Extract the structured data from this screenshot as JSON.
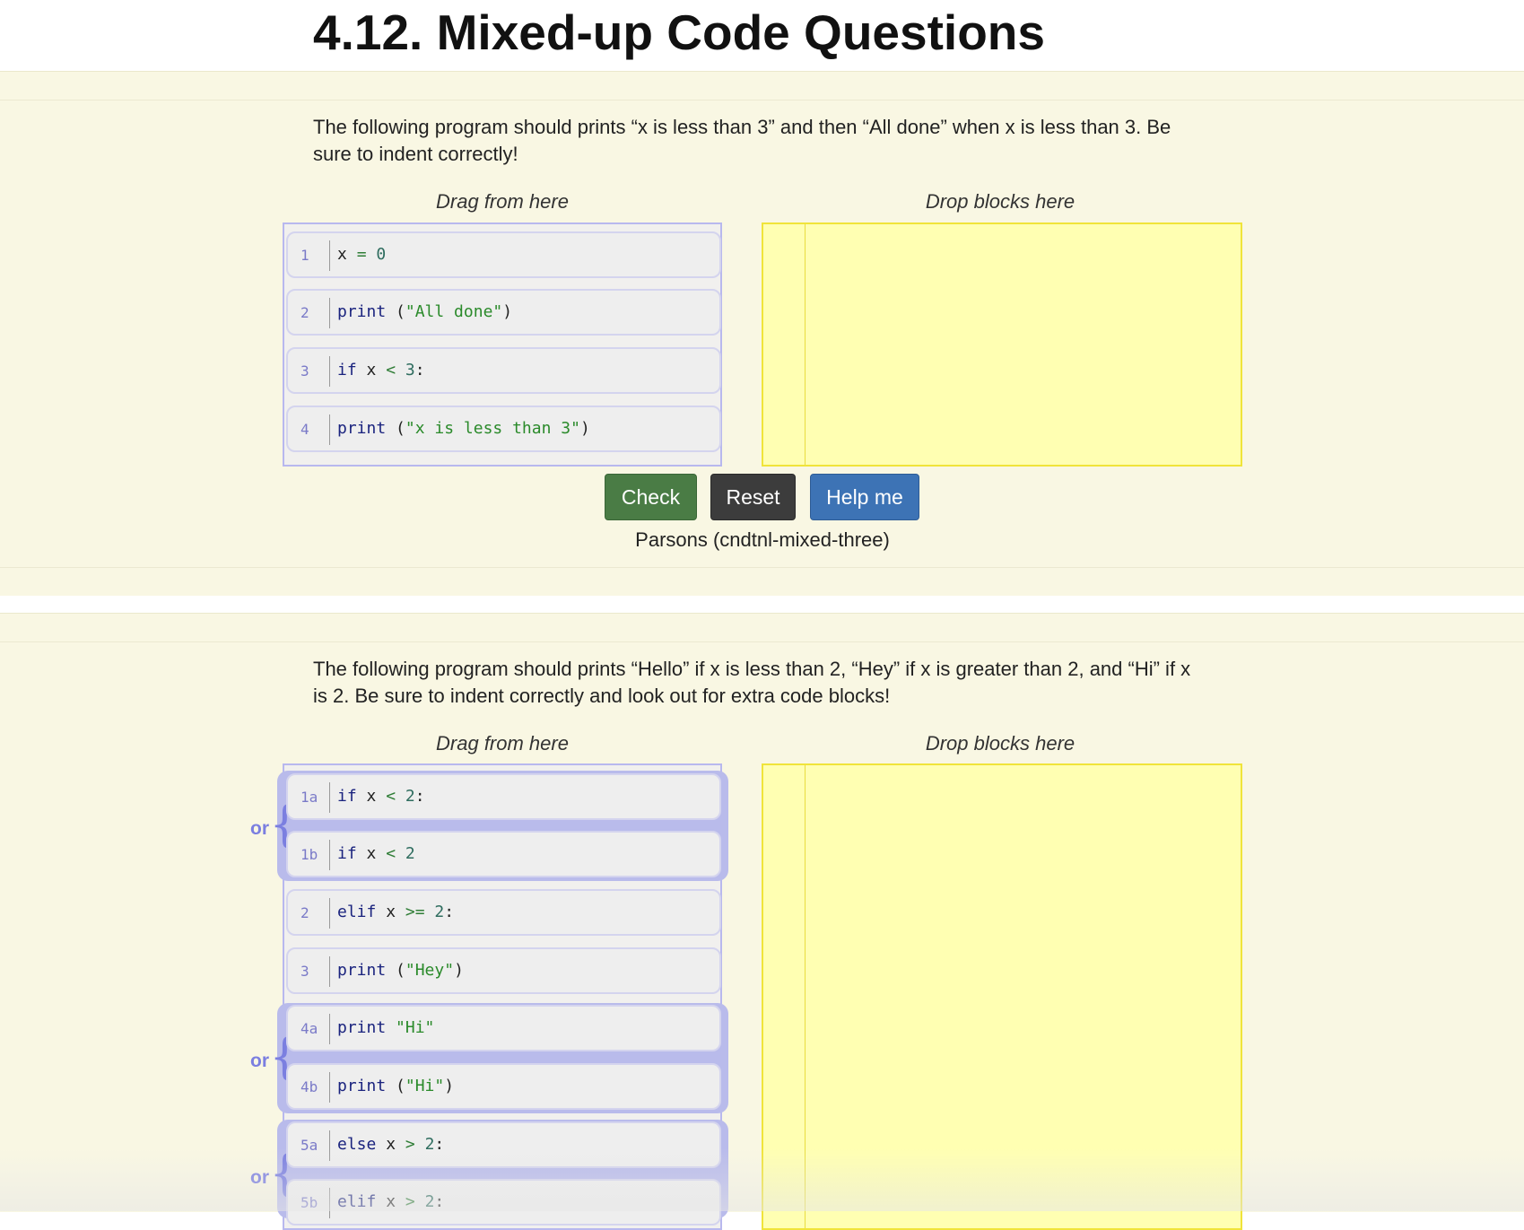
{
  "page": {
    "title": "4.12. Mixed-up Code Questions"
  },
  "question1": {
    "prompt": "The following program should prints “x is less than 3” and then “All done” when x is less than 3. Be sure to indent correctly!",
    "source_label": "Drag from here",
    "drop_label": "Drop blocks here",
    "blocks": [
      {
        "lineno": "1",
        "tokens": [
          [
            "t",
            "x "
          ],
          [
            "op",
            "="
          ],
          [
            "t",
            " "
          ],
          [
            "num",
            "0"
          ]
        ]
      },
      {
        "lineno": "2",
        "tokens": [
          [
            "kw",
            "print"
          ],
          [
            "t",
            " ("
          ],
          [
            "str",
            "\"All done\""
          ],
          [
            "t",
            ")"
          ]
        ]
      },
      {
        "lineno": "3",
        "tokens": [
          [
            "kw",
            "if"
          ],
          [
            "t",
            " x "
          ],
          [
            "op",
            "<"
          ],
          [
            "t",
            " "
          ],
          [
            "num",
            "3"
          ],
          [
            "t",
            ":"
          ]
        ]
      },
      {
        "lineno": "4",
        "tokens": [
          [
            "kw",
            "print"
          ],
          [
            "t",
            " ("
          ],
          [
            "str",
            "\"x is less than 3\""
          ],
          [
            "t",
            ")"
          ]
        ]
      }
    ],
    "buttons": {
      "check": "Check",
      "reset": "Reset",
      "help": "Help me"
    },
    "caption": "Parsons (cndtnl-mixed-three)"
  },
  "question2": {
    "prompt": "The following program should prints “Hello” if x is less than 2, “Hey” if x is greater than 2, and “Hi” if x is 2. Be sure to indent correctly and look out for extra code blocks!",
    "source_label": "Drag from here",
    "drop_label": "Drop blocks here",
    "or_label": "or",
    "blocks": [
      {
        "lineno": "1a",
        "tokens": [
          [
            "kw",
            "if"
          ],
          [
            "t",
            " x "
          ],
          [
            "op",
            "<"
          ],
          [
            "t",
            " "
          ],
          [
            "num",
            "2"
          ],
          [
            "t",
            ":"
          ]
        ]
      },
      {
        "lineno": "1b",
        "tokens": [
          [
            "kw",
            "if"
          ],
          [
            "t",
            " x "
          ],
          [
            "op",
            "<"
          ],
          [
            "t",
            " "
          ],
          [
            "num",
            "2"
          ]
        ]
      },
      {
        "lineno": "2",
        "tokens": [
          [
            "kw",
            "elif"
          ],
          [
            "t",
            " x "
          ],
          [
            "op",
            ">="
          ],
          [
            "t",
            " "
          ],
          [
            "num",
            "2"
          ],
          [
            "t",
            ":"
          ]
        ]
      },
      {
        "lineno": "3",
        "tokens": [
          [
            "kw",
            "print"
          ],
          [
            "t",
            " ("
          ],
          [
            "str",
            "\"Hey\""
          ],
          [
            "t",
            ")"
          ]
        ]
      },
      {
        "lineno": "4a",
        "tokens": [
          [
            "kw",
            "print"
          ],
          [
            "t",
            " "
          ],
          [
            "str",
            "\"Hi\""
          ]
        ]
      },
      {
        "lineno": "4b",
        "tokens": [
          [
            "kw",
            "print"
          ],
          [
            "t",
            " ("
          ],
          [
            "str",
            "\"Hi\""
          ],
          [
            "t",
            ")"
          ]
        ]
      },
      {
        "lineno": "5a",
        "tokens": [
          [
            "kw",
            "else"
          ],
          [
            "t",
            " x "
          ],
          [
            "op",
            ">"
          ],
          [
            "t",
            " "
          ],
          [
            "num",
            "2"
          ],
          [
            "t",
            ":"
          ]
        ]
      },
      {
        "lineno": "5b",
        "tokens": [
          [
            "kw",
            "elif"
          ],
          [
            "t",
            " x "
          ],
          [
            "op",
            ">"
          ],
          [
            "t",
            " "
          ],
          [
            "num",
            "2"
          ],
          [
            "t",
            ":"
          ]
        ]
      }
    ]
  }
}
